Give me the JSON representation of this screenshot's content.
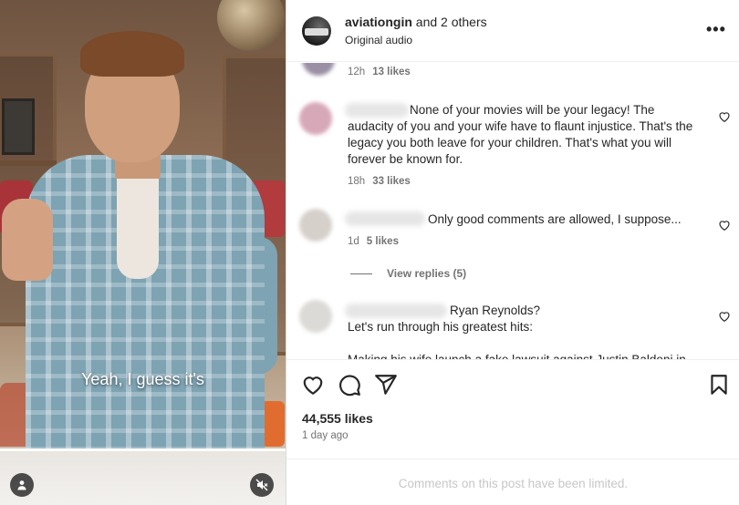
{
  "video": {
    "caption": "Yeah, I guess it's",
    "user_icon": "user-icon",
    "mute_icon": "muted-speaker-icon"
  },
  "header": {
    "username": "aviationgin",
    "collab_suffix": "and 2 others",
    "audio": "Original audio",
    "more_icon": "more-options-icon",
    "more_glyph": "•••"
  },
  "comments": [
    {
      "text": "",
      "time": "12h",
      "likes": "13 likes"
    },
    {
      "text": "None of your movies will be your legacy! The audacity of you and your wife have to flaunt injustice. That's the legacy you both leave for your children. That's what you will forever be known for.",
      "time": "18h",
      "likes": "33 likes"
    },
    {
      "text": "Only good comments are allowed, I suppose...",
      "time": "1d",
      "likes": "5 likes",
      "replies": "View replies (5)"
    },
    {
      "text_line1": "Ryan Reynolds?",
      "text_line2": "Let's run through his greatest hits:",
      "text_line3": "Making his wife launch a fake lawsuit against Justin Baldoni in"
    }
  ],
  "actions": {
    "like_icon": "heart-icon",
    "comment_icon": "comment-icon",
    "share_icon": "share-icon",
    "save_icon": "bookmark-icon",
    "likes": "44,555 likes",
    "posted": "1 day ago"
  },
  "footer": {
    "limited": "Comments on this post have been limited."
  },
  "colors": {
    "text": "#262626",
    "secondary": "#737373",
    "divider": "#efefef",
    "muted": "#c7c7c7"
  }
}
